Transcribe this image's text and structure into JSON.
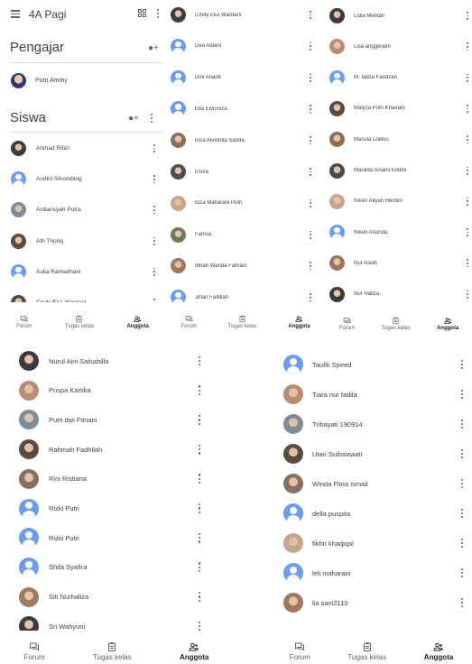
{
  "app": {
    "class_name": "4A Pagi",
    "teachers_title": "Pengajar",
    "students_title": "Siswa"
  },
  "nav": {
    "forum": "Forum",
    "classwork": "Tugas kelas",
    "members": "Anggota"
  },
  "colors": {
    "avatar_default": "#6b9cf0",
    "divider": "#dadce0",
    "text": "#3c4043"
  },
  "teachers": [
    {
      "name": "Putri Ammy",
      "avatar": "photo"
    }
  ],
  "students": {
    "screen1": [
      {
        "name": "Ahmad Rifa'i",
        "avatar": "photo"
      },
      {
        "name": "Andini Sihombing",
        "avatar": "default"
      },
      {
        "name": "Ardiansyah Putra",
        "avatar": "photo"
      },
      {
        "name": "Ath Thoriq",
        "avatar": "photo"
      },
      {
        "name": "Aulia Ramadhani",
        "avatar": "default"
      },
      {
        "name": "Cindy Eka Wardani",
        "avatar": "photo"
      }
    ],
    "screen2": [
      {
        "name": "Cindy Eka Wardani",
        "avatar": "photo"
      },
      {
        "name": "Dea Aldani",
        "avatar": "default"
      },
      {
        "name": "Dini Arianti",
        "avatar": "default"
      },
      {
        "name": "Ella Elvionica",
        "avatar": "default"
      },
      {
        "name": "Elsa Alvionita Sanda",
        "avatar": "photo"
      },
      {
        "name": "Elvira",
        "avatar": "photo"
      },
      {
        "name": "Elza Maharani Putri",
        "avatar": "photo"
      },
      {
        "name": "Fanisa",
        "avatar": "photo"
      },
      {
        "name": "Ibnah Wanda Fahrani",
        "avatar": "photo"
      },
      {
        "name": "Jihan Fadillah",
        "avatar": "default"
      }
    ],
    "screen3": [
      {
        "name": "Lidia Mentari",
        "avatar": "photo"
      },
      {
        "name": "Lisa anggeraini",
        "avatar": "photo"
      },
      {
        "name": "M. fadza Faudzan",
        "avatar": "default"
      },
      {
        "name": "Malyza Putri Khairani",
        "avatar": "photo"
      },
      {
        "name": "Masula Loebis",
        "avatar": "photo"
      },
      {
        "name": "Maulida Isnaini Endini",
        "avatar": "photo"
      },
      {
        "name": "Niken Aliyah Herdini",
        "avatar": "photo"
      },
      {
        "name": "Niken Ananda",
        "avatar": "default"
      },
      {
        "name": "Nur Asiah",
        "avatar": "photo"
      },
      {
        "name": "Nur Haliza",
        "avatar": "photo"
      }
    ],
    "screen4": [
      {
        "name": "Nurul Aini Salsabilla",
        "avatar": "photo"
      },
      {
        "name": "Puspa Kartika",
        "avatar": "photo"
      },
      {
        "name": "Putri dwi Fitriani",
        "avatar": "photo"
      },
      {
        "name": "Rahmah Fadhilah",
        "avatar": "photo"
      },
      {
        "name": "Rini Ristiana",
        "avatar": "photo"
      },
      {
        "name": "Rizki Putri",
        "avatar": "default"
      },
      {
        "name": "Rizki Putri",
        "avatar": "default"
      },
      {
        "name": "Shifa Syafira",
        "avatar": "default"
      },
      {
        "name": "Siti Nurhaliza",
        "avatar": "photo"
      },
      {
        "name": "Sri Wahyuni",
        "avatar": "photo"
      }
    ],
    "screen5": [
      {
        "name": "Taufik Speed",
        "avatar": "default"
      },
      {
        "name": "Tiara nur fadila",
        "avatar": "photo"
      },
      {
        "name": "Trihayati 190914",
        "avatar": "photo"
      },
      {
        "name": "Utari Sulistiawati",
        "avatar": "photo"
      },
      {
        "name": "Winda Fitria Ismail",
        "avatar": "photo"
      },
      {
        "name": "della puspita",
        "avatar": "default"
      },
      {
        "name": "fikhri khaqiqal",
        "avatar": "photo"
      },
      {
        "name": "leli maharani",
        "avatar": "default"
      },
      {
        "name": "lia sani2110",
        "avatar": "photo"
      }
    ]
  }
}
